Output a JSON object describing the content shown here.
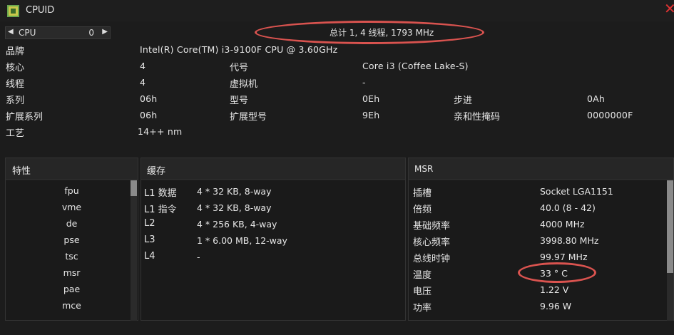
{
  "window": {
    "title": "CPUID"
  },
  "cpu_selector": {
    "label": "CPU",
    "value": "0"
  },
  "summary": "总计 1, 4 线程, 1793 MHz",
  "info": {
    "brand_label": "品牌",
    "brand_value": "Intel(R) Core(TM) i3-9100F CPU @ 3.60GHz",
    "cores_label": "核心",
    "cores_value": "4",
    "codename_label": "代号",
    "codename_value": "Core i3 (Coffee Lake-S)",
    "threads_label": "线程",
    "threads_value": "4",
    "vm_label": "虚拟机",
    "vm_value": "-",
    "family_label": "系列",
    "family_value": "06h",
    "model_label": "型号",
    "model_value": "0Eh",
    "stepping_label": "步进",
    "stepping_value": "0Ah",
    "ext_family_label": "扩展系列",
    "ext_family_value": "06h",
    "ext_model_label": "扩展型号",
    "ext_model_value": "9Eh",
    "affinity_label": "亲和性掩码",
    "affinity_value": "0000000F",
    "process_label": "工艺",
    "process_value": "14++ nm"
  },
  "features": {
    "title": "特性",
    "items": [
      "fpu",
      "vme",
      "de",
      "pse",
      "tsc",
      "msr",
      "pae",
      "mce"
    ]
  },
  "cache": {
    "title": "缓存",
    "rows": [
      {
        "label": "L1 数据",
        "value": "4 * 32 KB, 8-way"
      },
      {
        "label": "L1 指令",
        "value": "4 * 32 KB, 8-way"
      },
      {
        "label": "L2",
        "value": "4 * 256 KB, 4-way"
      },
      {
        "label": "L3",
        "value": "1 * 6.00 MB, 12-way"
      },
      {
        "label": "L4",
        "value": "-"
      }
    ]
  },
  "msr": {
    "title": "MSR",
    "rows": [
      {
        "label": "插槽",
        "value": "Socket LGA1151"
      },
      {
        "label": "倍频",
        "value": "40.0 (8 - 42)"
      },
      {
        "label": "基础频率",
        "value": "4000 MHz"
      },
      {
        "label": "核心频率",
        "value": "3998.80 MHz"
      },
      {
        "label": "总线时钟",
        "value": "99.97 MHz"
      },
      {
        "label": "温度",
        "value": "33 ° C"
      },
      {
        "label": "电压",
        "value": "1.22 V"
      },
      {
        "label": "功率",
        "value": "9.96 W"
      }
    ]
  },
  "colors": {
    "background": "#1c1c1c",
    "annotation": "#d9534f"
  }
}
